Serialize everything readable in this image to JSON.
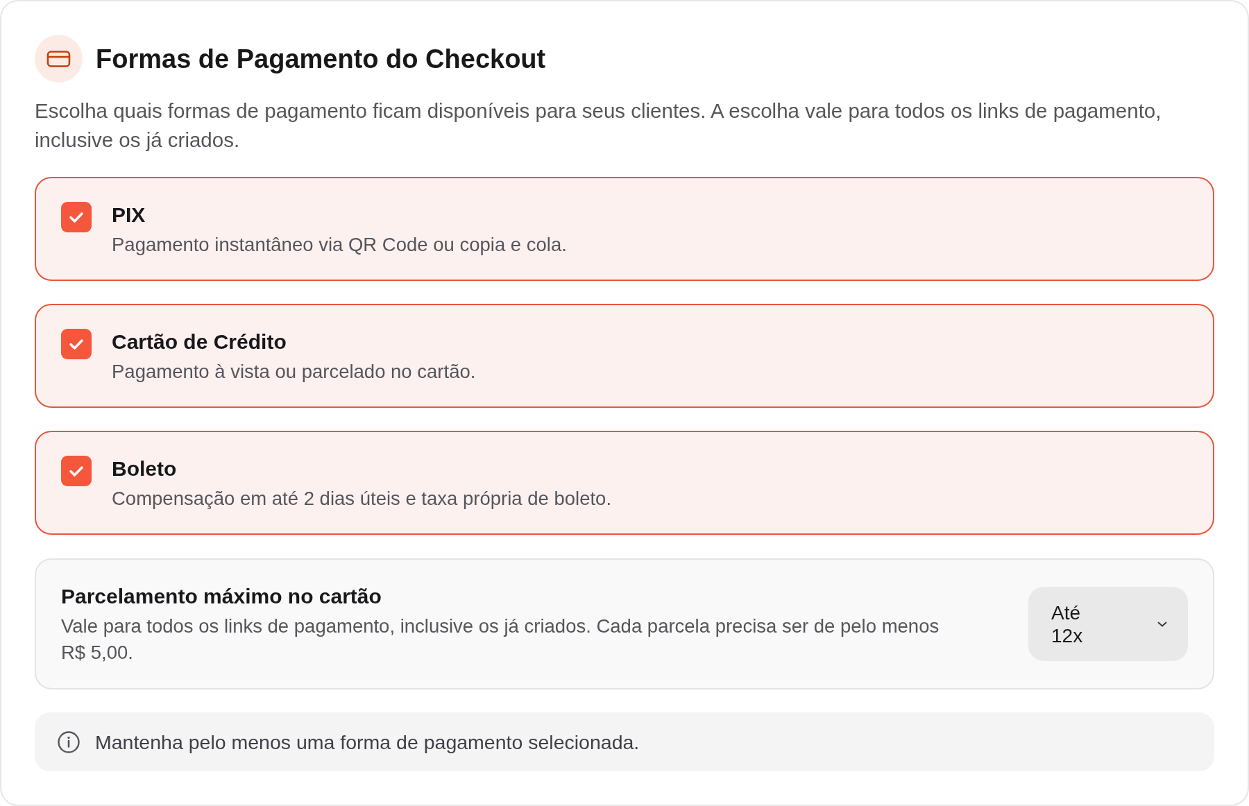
{
  "header": {
    "title": "Formas de Pagamento do Checkout",
    "description": "Escolha quais formas de pagamento ficam disponíveis para seus clientes. A escolha vale para todos os links de pagamento, inclusive os já criados."
  },
  "methods": [
    {
      "name": "PIX",
      "description": "Pagamento instantâneo via QR Code ou copia e cola.",
      "checked": true
    },
    {
      "name": "Cartão de Crédito",
      "description": "Pagamento à vista ou parcelado no cartão.",
      "checked": true
    },
    {
      "name": "Boleto",
      "description": "Compensação em até 2 dias úteis e taxa própria de boleto.",
      "checked": true
    }
  ],
  "installments": {
    "title": "Parcelamento máximo no cartão",
    "description": "Vale para todos os links de pagamento, inclusive os já criados. Cada parcela precisa ser de pelo menos R$ 5,00.",
    "select": {
      "value": "Até 12x"
    }
  },
  "notice": {
    "text": "Mantenha pelo menos uma forma de pagamento selecionada."
  }
}
